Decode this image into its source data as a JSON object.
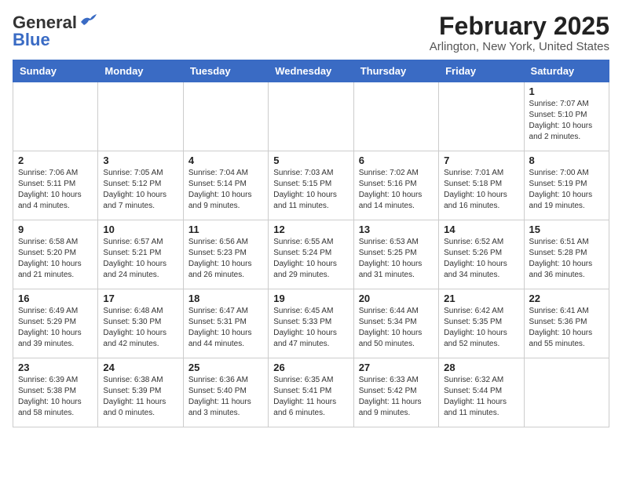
{
  "header": {
    "logo_general": "General",
    "logo_blue": "Blue",
    "month_title": "February 2025",
    "location": "Arlington, New York, United States"
  },
  "weekdays": [
    "Sunday",
    "Monday",
    "Tuesday",
    "Wednesday",
    "Thursday",
    "Friday",
    "Saturday"
  ],
  "weeks": [
    [
      {
        "day": "",
        "info": ""
      },
      {
        "day": "",
        "info": ""
      },
      {
        "day": "",
        "info": ""
      },
      {
        "day": "",
        "info": ""
      },
      {
        "day": "",
        "info": ""
      },
      {
        "day": "",
        "info": ""
      },
      {
        "day": "1",
        "info": "Sunrise: 7:07 AM\nSunset: 5:10 PM\nDaylight: 10 hours and 2 minutes."
      }
    ],
    [
      {
        "day": "2",
        "info": "Sunrise: 7:06 AM\nSunset: 5:11 PM\nDaylight: 10 hours and 4 minutes."
      },
      {
        "day": "3",
        "info": "Sunrise: 7:05 AM\nSunset: 5:12 PM\nDaylight: 10 hours and 7 minutes."
      },
      {
        "day": "4",
        "info": "Sunrise: 7:04 AM\nSunset: 5:14 PM\nDaylight: 10 hours and 9 minutes."
      },
      {
        "day": "5",
        "info": "Sunrise: 7:03 AM\nSunset: 5:15 PM\nDaylight: 10 hours and 11 minutes."
      },
      {
        "day": "6",
        "info": "Sunrise: 7:02 AM\nSunset: 5:16 PM\nDaylight: 10 hours and 14 minutes."
      },
      {
        "day": "7",
        "info": "Sunrise: 7:01 AM\nSunset: 5:18 PM\nDaylight: 10 hours and 16 minutes."
      },
      {
        "day": "8",
        "info": "Sunrise: 7:00 AM\nSunset: 5:19 PM\nDaylight: 10 hours and 19 minutes."
      }
    ],
    [
      {
        "day": "9",
        "info": "Sunrise: 6:58 AM\nSunset: 5:20 PM\nDaylight: 10 hours and 21 minutes."
      },
      {
        "day": "10",
        "info": "Sunrise: 6:57 AM\nSunset: 5:21 PM\nDaylight: 10 hours and 24 minutes."
      },
      {
        "day": "11",
        "info": "Sunrise: 6:56 AM\nSunset: 5:23 PM\nDaylight: 10 hours and 26 minutes."
      },
      {
        "day": "12",
        "info": "Sunrise: 6:55 AM\nSunset: 5:24 PM\nDaylight: 10 hours and 29 minutes."
      },
      {
        "day": "13",
        "info": "Sunrise: 6:53 AM\nSunset: 5:25 PM\nDaylight: 10 hours and 31 minutes."
      },
      {
        "day": "14",
        "info": "Sunrise: 6:52 AM\nSunset: 5:26 PM\nDaylight: 10 hours and 34 minutes."
      },
      {
        "day": "15",
        "info": "Sunrise: 6:51 AM\nSunset: 5:28 PM\nDaylight: 10 hours and 36 minutes."
      }
    ],
    [
      {
        "day": "16",
        "info": "Sunrise: 6:49 AM\nSunset: 5:29 PM\nDaylight: 10 hours and 39 minutes."
      },
      {
        "day": "17",
        "info": "Sunrise: 6:48 AM\nSunset: 5:30 PM\nDaylight: 10 hours and 42 minutes."
      },
      {
        "day": "18",
        "info": "Sunrise: 6:47 AM\nSunset: 5:31 PM\nDaylight: 10 hours and 44 minutes."
      },
      {
        "day": "19",
        "info": "Sunrise: 6:45 AM\nSunset: 5:33 PM\nDaylight: 10 hours and 47 minutes."
      },
      {
        "day": "20",
        "info": "Sunrise: 6:44 AM\nSunset: 5:34 PM\nDaylight: 10 hours and 50 minutes."
      },
      {
        "day": "21",
        "info": "Sunrise: 6:42 AM\nSunset: 5:35 PM\nDaylight: 10 hours and 52 minutes."
      },
      {
        "day": "22",
        "info": "Sunrise: 6:41 AM\nSunset: 5:36 PM\nDaylight: 10 hours and 55 minutes."
      }
    ],
    [
      {
        "day": "23",
        "info": "Sunrise: 6:39 AM\nSunset: 5:38 PM\nDaylight: 10 hours and 58 minutes."
      },
      {
        "day": "24",
        "info": "Sunrise: 6:38 AM\nSunset: 5:39 PM\nDaylight: 11 hours and 0 minutes."
      },
      {
        "day": "25",
        "info": "Sunrise: 6:36 AM\nSunset: 5:40 PM\nDaylight: 11 hours and 3 minutes."
      },
      {
        "day": "26",
        "info": "Sunrise: 6:35 AM\nSunset: 5:41 PM\nDaylight: 11 hours and 6 minutes."
      },
      {
        "day": "27",
        "info": "Sunrise: 6:33 AM\nSunset: 5:42 PM\nDaylight: 11 hours and 9 minutes."
      },
      {
        "day": "28",
        "info": "Sunrise: 6:32 AM\nSunset: 5:44 PM\nDaylight: 11 hours and 11 minutes."
      },
      {
        "day": "",
        "info": ""
      }
    ]
  ]
}
